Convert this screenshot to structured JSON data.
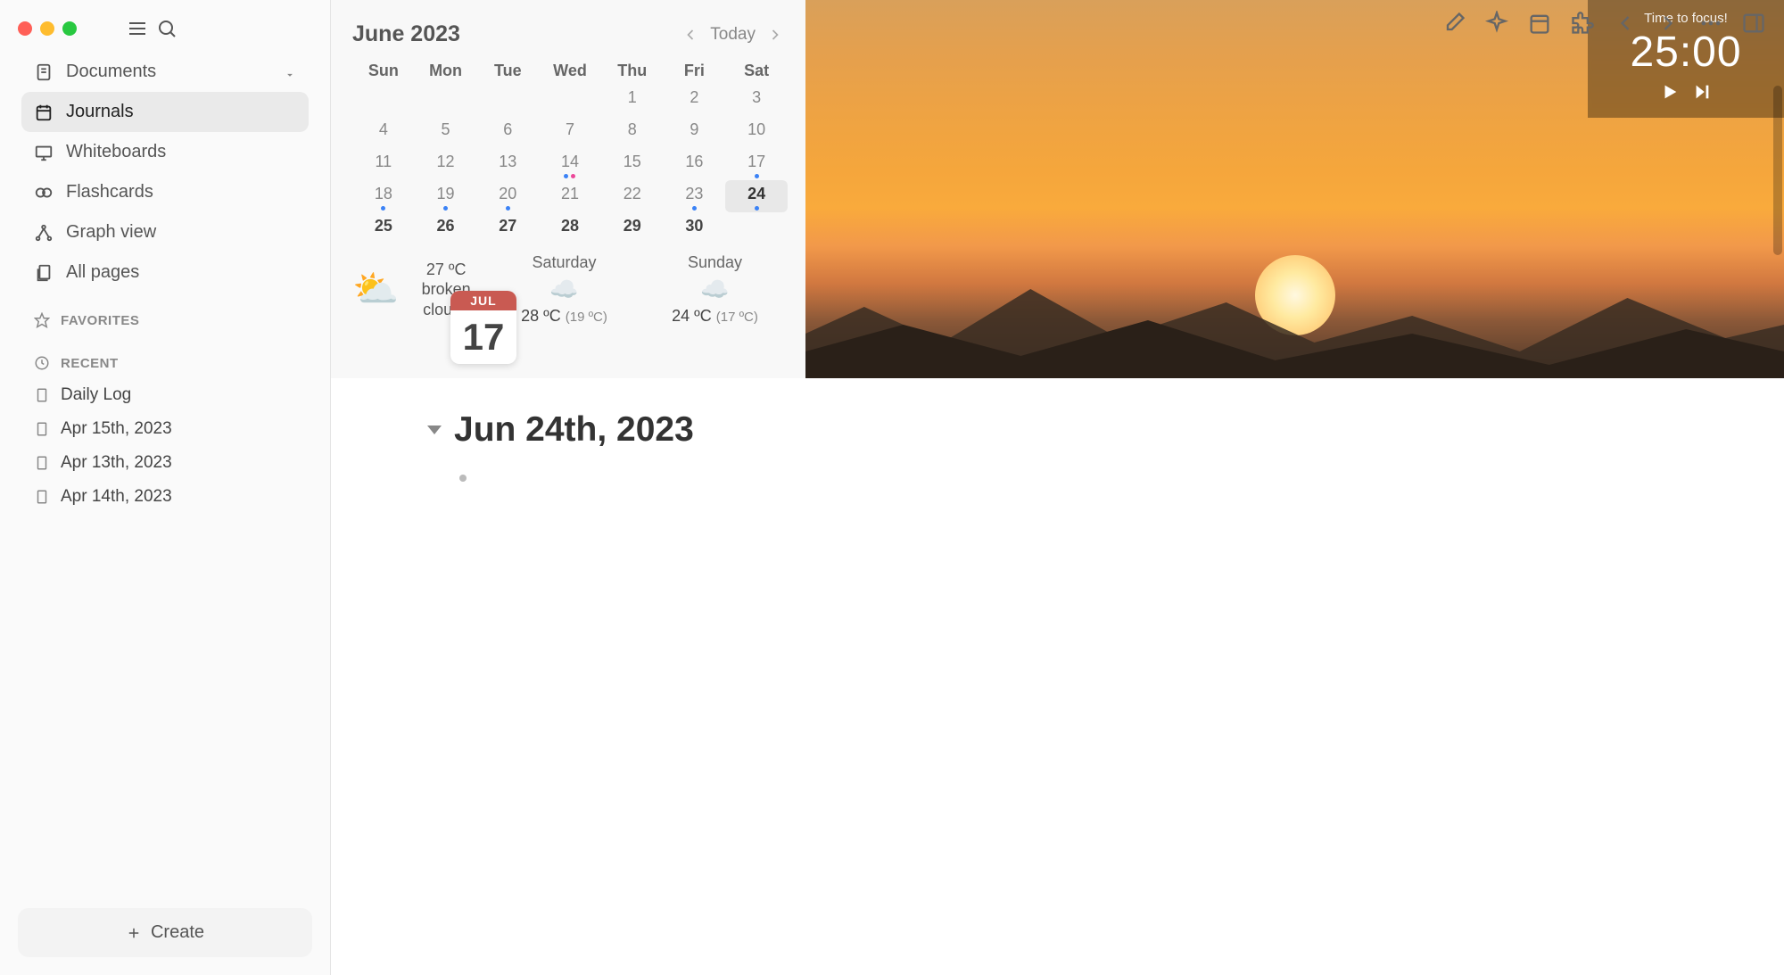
{
  "sidebar": {
    "items": [
      {
        "label": "Documents",
        "icon": "documents-icon",
        "dropdown": true
      },
      {
        "label": "Journals",
        "icon": "calendar-icon",
        "active": true
      },
      {
        "label": "Whiteboards",
        "icon": "whiteboard-icon"
      },
      {
        "label": "Flashcards",
        "icon": "flashcards-icon"
      },
      {
        "label": "Graph view",
        "icon": "graph-icon"
      },
      {
        "label": "All pages",
        "icon": "pages-icon"
      }
    ],
    "favorites_label": "FAVORITES",
    "recent_label": "RECENT",
    "recent_items": [
      {
        "label": "Daily Log"
      },
      {
        "label": "Apr 15th, 2023"
      },
      {
        "label": "Apr 13th, 2023"
      },
      {
        "label": "Apr 14th, 2023"
      }
    ],
    "create_label": "Create"
  },
  "calendar": {
    "title": "June 2023",
    "today_label": "Today",
    "days_of_week": [
      "Sun",
      "Mon",
      "Tue",
      "Wed",
      "Thu",
      "Fri",
      "Sat"
    ],
    "weeks": [
      [
        {
          "n": "",
          "m": 0
        },
        {
          "n": "",
          "m": 0
        },
        {
          "n": "",
          "m": 0
        },
        {
          "n": "",
          "m": 0
        },
        {
          "n": "1",
          "m": 1
        },
        {
          "n": "2",
          "m": 1
        },
        {
          "n": "3",
          "m": 1
        }
      ],
      [
        {
          "n": "4",
          "m": 1
        },
        {
          "n": "5",
          "m": 1
        },
        {
          "n": "6",
          "m": 1
        },
        {
          "n": "7",
          "m": 1
        },
        {
          "n": "8",
          "m": 1
        },
        {
          "n": "9",
          "m": 1
        },
        {
          "n": "10",
          "m": 1
        }
      ],
      [
        {
          "n": "11",
          "m": 1
        },
        {
          "n": "12",
          "m": 1
        },
        {
          "n": "13",
          "m": 1
        },
        {
          "n": "14",
          "m": 1,
          "dots": [
            "blue",
            "pink"
          ]
        },
        {
          "n": "15",
          "m": 1
        },
        {
          "n": "16",
          "m": 1
        },
        {
          "n": "17",
          "m": 1,
          "dots": [
            "blue"
          ]
        }
      ],
      [
        {
          "n": "18",
          "m": 1,
          "dots": [
            "blue"
          ]
        },
        {
          "n": "19",
          "m": 1,
          "dots": [
            "blue"
          ]
        },
        {
          "n": "20",
          "m": 1,
          "dots": [
            "blue"
          ]
        },
        {
          "n": "21",
          "m": 1
        },
        {
          "n": "22",
          "m": 1
        },
        {
          "n": "23",
          "m": 1,
          "dots": [
            "blue"
          ]
        },
        {
          "n": "24",
          "m": 1,
          "selected": 1,
          "dots": [
            "blue"
          ]
        }
      ],
      [
        {
          "n": "25",
          "m": 1,
          "b": 1
        },
        {
          "n": "26",
          "m": 1,
          "b": 1
        },
        {
          "n": "27",
          "m": 1,
          "b": 1
        },
        {
          "n": "28",
          "m": 1,
          "b": 1
        },
        {
          "n": "29",
          "m": 1,
          "b": 1
        },
        {
          "n": "30",
          "m": 1,
          "b": 1
        },
        {
          "n": "",
          "m": 0
        }
      ]
    ]
  },
  "weather": {
    "today": {
      "emoji": "⛅",
      "temp": "27 ºC",
      "desc": "broken clouds"
    },
    "forecast": [
      {
        "day": "Saturday",
        "emoji": "☁️",
        "hi": "28 ºC",
        "lo": "(19 ºC)"
      },
      {
        "day": "Sunday",
        "emoji": "☁️",
        "hi": "24 ºC",
        "lo": "(17 ºC)"
      }
    ]
  },
  "date_badge": {
    "month": "JUL",
    "day": "17"
  },
  "focus": {
    "label": "Time to focus!",
    "time": "25:00"
  },
  "page": {
    "title": "Jun 24th, 2023"
  }
}
